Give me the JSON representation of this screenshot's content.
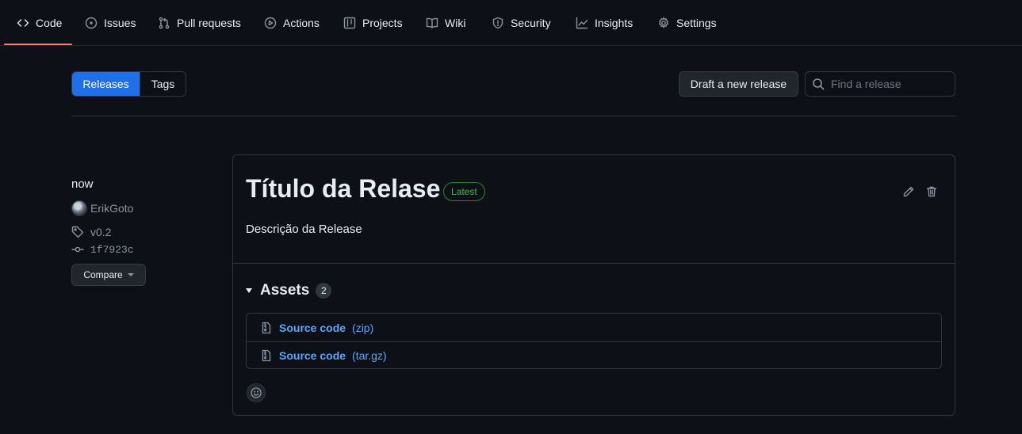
{
  "nav": {
    "tabs": [
      {
        "label": "Code",
        "icon": "code-icon"
      },
      {
        "label": "Issues",
        "icon": "issue-opened-icon"
      },
      {
        "label": "Pull requests",
        "icon": "git-pull-request-icon"
      },
      {
        "label": "Actions",
        "icon": "play-icon"
      },
      {
        "label": "Projects",
        "icon": "table-icon"
      },
      {
        "label": "Wiki",
        "icon": "book-icon"
      },
      {
        "label": "Security",
        "icon": "shield-icon"
      },
      {
        "label": "Insights",
        "icon": "graph-icon"
      },
      {
        "label": "Settings",
        "icon": "gear-icon"
      }
    ],
    "active_tab": "Code"
  },
  "toolbar": {
    "releases_label": "Releases",
    "tags_label": "Tags",
    "draft_label": "Draft a new release",
    "search_placeholder": "Find a release"
  },
  "release": {
    "when": "now",
    "author": "ErikGoto",
    "tag": "v0.2",
    "commit": "1f7923c",
    "compare_label": "Compare",
    "title": "Título da Relase",
    "badge": "Latest",
    "description": "Descrição da Release",
    "assets_title": "Assets",
    "assets_count": "2",
    "assets": [
      {
        "name": "Source code",
        "ext": "(zip)"
      },
      {
        "name": "Source code",
        "ext": "(tar.gz)"
      }
    ]
  },
  "colors": {
    "accent": "#1f6feb",
    "link": "#58a6ff",
    "latest_badge": "#3fb950",
    "active_underline": "#f78166",
    "background": "#0d1117"
  }
}
